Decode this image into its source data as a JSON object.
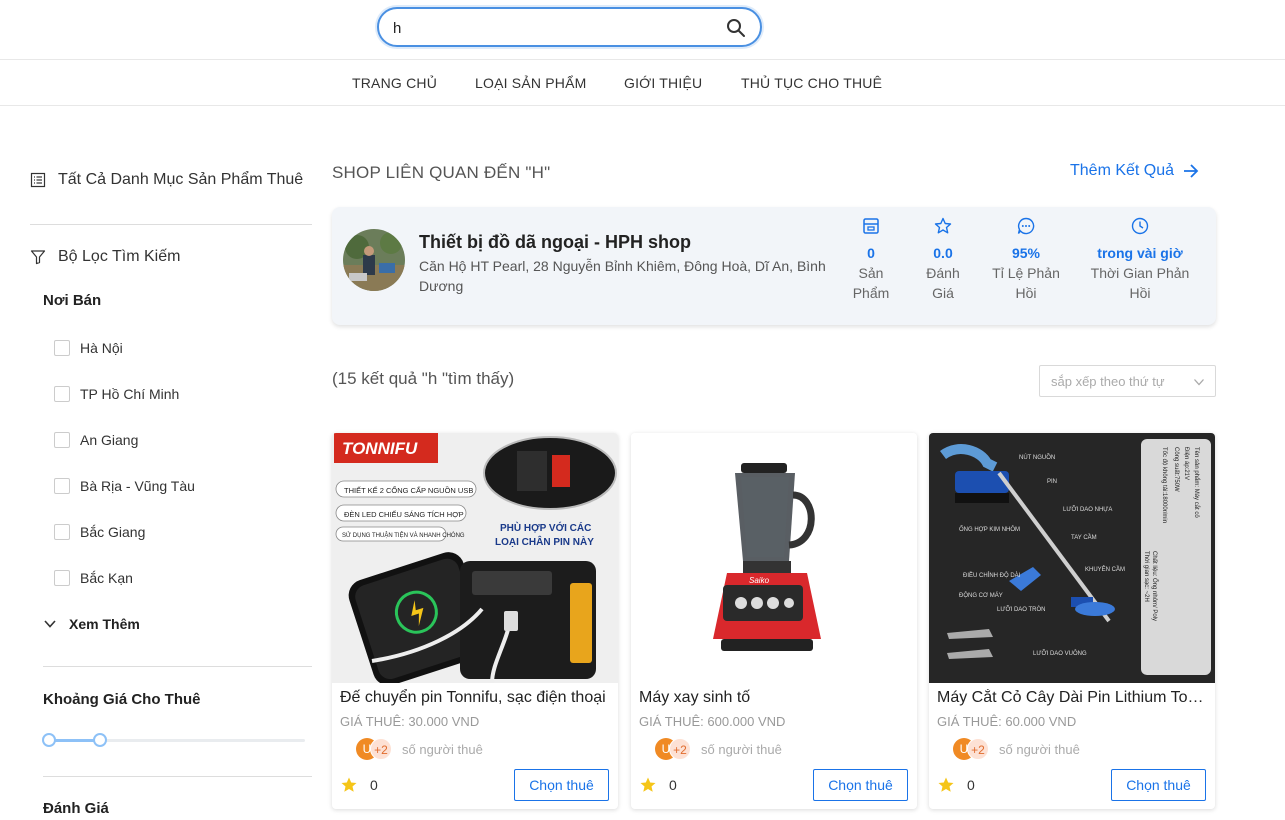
{
  "search": {
    "value": "h"
  },
  "nav": {
    "items": [
      "TRANG CHỦ",
      "LOẠI SẢN PHẨM",
      "GIỚI THIỆU",
      "THỦ TỤC CHO THUÊ"
    ]
  },
  "sidebar": {
    "all_categories": "Tất Cả Danh Mục Sản Phẩm Thuê",
    "filter_title": "Bộ Lọc Tìm Kiếm",
    "location_title": "Nơi Bán",
    "locations": [
      "Hà Nội",
      "TP Hồ Chí Minh",
      "An Giang",
      "Bà Rịa - Vũng Tàu",
      "Bắc Giang",
      "Bắc Kạn"
    ],
    "see_more": "Xem Thêm",
    "price_title": "Khoảng Giá Cho Thuê",
    "rating_title": "Đánh Giá"
  },
  "shop_section": {
    "title": "SHOP LIÊN QUAN ĐẾN \"H\"",
    "more_results": "Thêm Kết Quả",
    "shop": {
      "name": "Thiết bị đồ dã ngoại - HPH shop",
      "address": "Căn Hộ HT Pearl, 28 Nguyễn Bỉnh Khiêm, Đông Hoà, Dĩ An, Bình Dương",
      "stats": [
        {
          "value": "0",
          "label": "Sản Phẩm",
          "icon": "store-icon"
        },
        {
          "value": "0.0",
          "label": "Đánh Giá",
          "icon": "star-outline-icon"
        },
        {
          "value": "95%",
          "label": "Tỉ Lệ Phản Hồi",
          "icon": "chat-icon"
        },
        {
          "value": "trong vài giờ",
          "label": "Thời Gian Phản Hồi",
          "icon": "clock-icon"
        }
      ]
    }
  },
  "results": {
    "count_text": "(15 kết quả \"h \"tìm thấy)",
    "sort_placeholder": "sắp xếp theo thứ tự"
  },
  "products": [
    {
      "title": "Đế chuyển pin Tonnifu, sạc điện thoại",
      "price": "GIÁ THUÊ: 30.000 VND",
      "avatar": "U",
      "extra": "+2",
      "renters_label": "số người thuê",
      "rating": "0",
      "button": "Chọn thuê",
      "image_text": {
        "brand": "TONNIFU",
        "f1": "THIẾT KẾ 2 CỔNG CẤP NGUỒN USB",
        "f2": "ĐÈN LED CHIẾU SÁNG TÍCH HỢP",
        "f3": "SỬ DỤNG THUẬN TIỆN VÀ NHANH CHÓNG",
        "fit": "PHÙ HỢP VỚI CÁC",
        "fit2": "LOẠI CHÂN PIN NÀY"
      }
    },
    {
      "title": "Máy xay sinh tố",
      "price": "GIÁ THUÊ: 600.000 VND",
      "avatar": "U",
      "extra": "+2",
      "renters_label": "số người thuê",
      "rating": "0",
      "button": "Chọn thuê",
      "image_text": {
        "brand": "Saiko"
      }
    },
    {
      "title": "Máy Cắt Cỏ Cây Dài Pin Lithium Tonnifu",
      "price": "GIÁ THUÊ: 60.000 VND",
      "avatar": "U",
      "extra": "+2",
      "renters_label": "số người thuê",
      "rating": "0",
      "button": "Chọn thuê",
      "image_text": {
        "l1": "NÚT NGUỒN",
        "l2": "PIN",
        "l3": "LƯỠI DAO NHỰA",
        "l4": "ỐNG HỢP KIM NHÔM",
        "l5": "TAY CẦM",
        "l6": "KHUYÊN CẦM",
        "l7": "ĐIỀU CHỈNH ĐỘ DÀI",
        "l8": "ĐỘNG CƠ MÁY",
        "l9": "LƯỠI DAO TRÒN",
        "l10": "LƯỠI DAO VUÔNG",
        "s1": "Tên sản phẩm: Máy cắt cỏ",
        "s2": "Điện áp:21V",
        "s3": "Công suất:750W",
        "s4": "Tốc độ không tải:18000r/min",
        "s5": "Chất liệu: Ống nhôm/ Poly",
        "s6": "Thời gian sạc: ~2H"
      }
    }
  ]
}
